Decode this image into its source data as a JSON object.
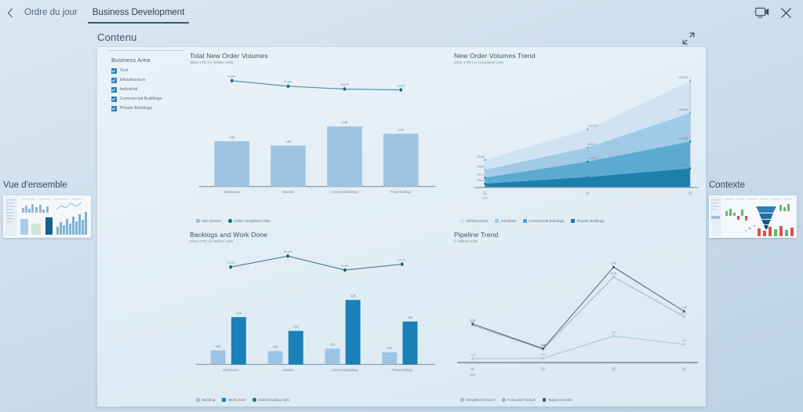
{
  "topbar": {
    "back_icon": "chevron-left-icon",
    "breadcrumb": "Ordre du jour",
    "active_tab": "Business Development",
    "screen_share_icon": "screen-share-icon",
    "close_icon": "close-icon"
  },
  "panel": {
    "label": "Contenu",
    "expand_icon": "expand-icon"
  },
  "filter": {
    "title": "Business Area",
    "items": [
      {
        "label": "Tout",
        "checked": true
      },
      {
        "label": "Infrastructure",
        "checked": true
      },
      {
        "label": "Industrial",
        "checked": true
      },
      {
        "label": "Commercial Buildings",
        "checked": true
      },
      {
        "label": "Private Buildings",
        "checked": true
      }
    ]
  },
  "sides": {
    "left": {
      "title": "Vue d'ensemble"
    },
    "right": {
      "title": "Contexte"
    }
  },
  "colors": {
    "accent": "#2d7fb8",
    "bar_light": "#9ec4e4",
    "bar_dark": "#1a80b8",
    "line_dark": "#1e6c8c",
    "area_1": "#cfe2f2",
    "area_2": "#9fc9e6",
    "area_3": "#5ba8cf",
    "area_4": "#1b7fa8"
  },
  "chart_data": [
    {
      "type": "bar",
      "id": "total-new-order-volumes",
      "title": "Total New Order Volumes",
      "subtitle": "2016 YTD | in Million USD",
      "categories": [
        "Infrastructure",
        "Industrial",
        "Commercial Buildings",
        "Private Buildings"
      ],
      "xlabel": "",
      "ylabel": "",
      "ylim": [
        0,
        6
      ],
      "grid": false,
      "legend_position": "bottom",
      "series": [
        {
          "name": "Net Amount",
          "kind": "bar",
          "values": [
            4.08,
            3.69,
            5.4,
            4.75
          ],
          "labels": [
            "4.08",
            "3.69",
            "5.40",
            "4.75"
          ]
        },
        {
          "name": "Order completion ratio",
          "kind": "line",
          "values": [
            48.64,
            47.3,
            46.62,
            46.42
          ],
          "labels": [
            "48.64%",
            "47.30%",
            "46.62%",
            "46.42%"
          ]
        }
      ]
    },
    {
      "type": "area",
      "id": "new-order-volumes-trend",
      "title": "New Order Volumes Trend",
      "subtitle": "2016 YTD | in Thousand USD",
      "categories": [
        "Q1",
        "Q2",
        "Q3"
      ],
      "axis_note": "2016",
      "xlabel": "",
      "ylabel": "",
      "ylim": [
        0,
        2200
      ],
      "grid": false,
      "stacked": true,
      "legend_position": "bottom",
      "series": [
        {
          "name": "Infrastructure",
          "values": [
            639.55,
            1187.59,
            2072.99
          ],
          "labels": [
            "639.55",
            "1,187.59",
            "2,072.99"
          ]
        },
        {
          "name": "Industrial",
          "values": [
            508.03,
            914.51,
            1855.69
          ],
          "labels": [
            "508.03",
            "914.51",
            "1,855.69"
          ]
        },
        {
          "name": "Commercial Buildings",
          "values": [
            391.12,
            1005.16,
            1750.68
          ],
          "labels": [
            "391.12",
            "1,005.16",
            "1,750.68"
          ]
        },
        {
          "name": "Private Buildings",
          "values": [
            244.0,
            670.62,
            1229.98
          ],
          "labels": [
            "244.00",
            "670.62",
            "1,229.98"
          ]
        }
      ]
    },
    {
      "type": "bar",
      "id": "backlogs-and-work-done",
      "title": "Backlogs and Work Done",
      "subtitle": "2016 YTD | in Million USD",
      "categories": [
        "Infrastructure",
        "Industrial",
        "Commercial Buildings",
        "Private Buildings"
      ],
      "xlabel": "",
      "ylabel": "",
      "ylim": [
        0,
        4.8
      ],
      "grid": false,
      "legend_position": "bottom",
      "series": [
        {
          "name": "Backlog",
          "kind": "bar",
          "values": [
            0.94,
            0.89,
            1.05,
            0.81
          ],
          "labels": [
            "0.94",
            "0.89",
            "1.05",
            "0.81"
          ]
        },
        {
          "name": "Work done",
          "kind": "bar",
          "values": [
            3.14,
            2.23,
            4.28,
            2.85
          ],
          "labels": [
            "3.14",
            "2.23",
            "4.28",
            "2.85"
          ]
        },
        {
          "name": "Sales backlog ratio",
          "kind": "line",
          "values": [
            22.12,
            26.44,
            20.93,
            23.24
          ],
          "labels": [
            "22.12%",
            "26.44%",
            "20.93%",
            "23.24%"
          ]
        }
      ]
    },
    {
      "type": "line",
      "id": "pipeline-trend",
      "title": "Pipeline Trend",
      "subtitle": "in Million USD",
      "categories": [
        "Q1",
        "Q2",
        "Q3",
        "Q4"
      ],
      "axis_note": "2016",
      "xlabel": "",
      "ylabel": "",
      "ylim": [
        0,
        15
      ],
      "grid": false,
      "legend_position": "bottom",
      "series": [
        {
          "name": "Weighted Amount",
          "values": [
            0.56,
            0.63,
            3.88,
            2.65
          ],
          "labels": [
            "0.56",
            "0.63",
            "3.88",
            "2.65"
          ]
        },
        {
          "name": "Forecast Amount",
          "values": [
            5.43,
            1.94,
            12.49,
            6.71
          ],
          "labels": [
            "5.43",
            "1.94",
            "12.49",
            "6.71"
          ]
        },
        {
          "name": "Target Amount",
          "values": [
            5.63,
            2.04,
            13.93,
            7.48
          ],
          "labels": [
            "5.63",
            "2.04",
            "13.93",
            "7.48"
          ]
        }
      ]
    }
  ]
}
